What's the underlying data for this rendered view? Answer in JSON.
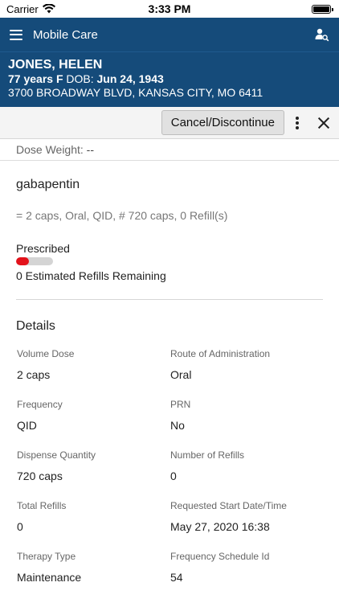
{
  "status": {
    "carrier": "Carrier",
    "time": "3:33 PM",
    "battery_level": 1.0
  },
  "header": {
    "title": "Mobile Care",
    "menu_icon": "hamburger-menu-icon",
    "user_icon": "user-search-icon"
  },
  "patient": {
    "name": "JONES, HELEN",
    "age_sex": "77 years F",
    "dob_label": "DOB:",
    "dob": "Jun 24, 1943",
    "address": "3700 BROADWAY BLVD, KANSAS CITY, MO 6411"
  },
  "actions": {
    "cancel_label": "Cancel/Discontinue"
  },
  "dose_weight": {
    "label": "Dose Weight:",
    "value": "--"
  },
  "medication": {
    "name": "gabapentin",
    "sig": "= 2 caps, Oral, QID, # 720 caps, 0 Refill(s)",
    "status": "Prescribed",
    "refills_progress": 0.35,
    "refills_remaining": "0 Estimated Refills Remaining"
  },
  "details": {
    "title": "Details",
    "fields": [
      {
        "label": "Volume Dose",
        "value": "2 caps"
      },
      {
        "label": "Route of Administration",
        "value": "Oral"
      },
      {
        "label": "Frequency",
        "value": "QID"
      },
      {
        "label": "PRN",
        "value": "No"
      },
      {
        "label": "Dispense Quantity",
        "value": "720 caps"
      },
      {
        "label": "Number of Refills",
        "value": "0"
      },
      {
        "label": "Total Refills",
        "value": "0"
      },
      {
        "label": "Requested Start Date/Time",
        "value": "May 27, 2020 16:38"
      },
      {
        "label": "Therapy Type",
        "value": "Maintenance"
      },
      {
        "label": "Frequency Schedule Id",
        "value": "54"
      }
    ]
  },
  "colors": {
    "header_bg": "#154b7a",
    "progress_fill": "#e3121b"
  }
}
